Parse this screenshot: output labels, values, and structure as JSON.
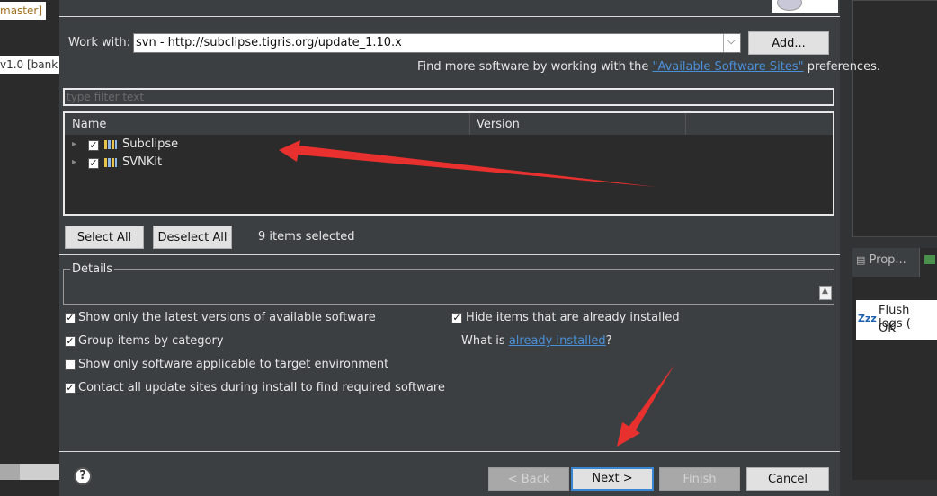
{
  "background": {
    "left_tags": [
      "master]",
      "v1.0  [bank"
    ],
    "right_tab_label": "Prop...",
    "flush_title": "Flush logs (",
    "flush_status": "OK",
    "zzz_icon_text": "Zzz"
  },
  "work_with": {
    "label": "Work with:",
    "value": "svn - http://subclipse.tigris.org/update_1.10.x",
    "add_button": "Add..."
  },
  "find_more": {
    "prefix": "Find more software by working with the",
    "link": "\"Available Software Sites\"",
    "suffix": "preferences."
  },
  "filter": {
    "placeholder": "type filter text"
  },
  "table": {
    "columns": [
      "Name",
      "Version"
    ],
    "rows": [
      {
        "name": "Subclipse",
        "checked": true,
        "version": ""
      },
      {
        "name": "SVNKit",
        "checked": true,
        "version": ""
      }
    ]
  },
  "selection": {
    "select_all": "Select All",
    "deselect_all": "Deselect All",
    "status": "9 items selected"
  },
  "details": {
    "title": "Details"
  },
  "options": {
    "latest_versions": "Show only the latest versions of available software",
    "group_by_category": "Group items by category",
    "target_env": "Show only software applicable to target environment",
    "contact_sites": "Contact all update sites during install to find required software",
    "hide_installed": "Hide items that are already installed",
    "what_is": "What is",
    "already_installed": "already installed",
    "question_mark": "?"
  },
  "footer": {
    "help": "?",
    "back": "< Back",
    "next": "Next >",
    "finish": "Finish",
    "cancel": "Cancel"
  },
  "colors": {
    "accent": "#3a86d1",
    "annotation_arrow": "#e8312f",
    "link": "#4a90d9"
  }
}
